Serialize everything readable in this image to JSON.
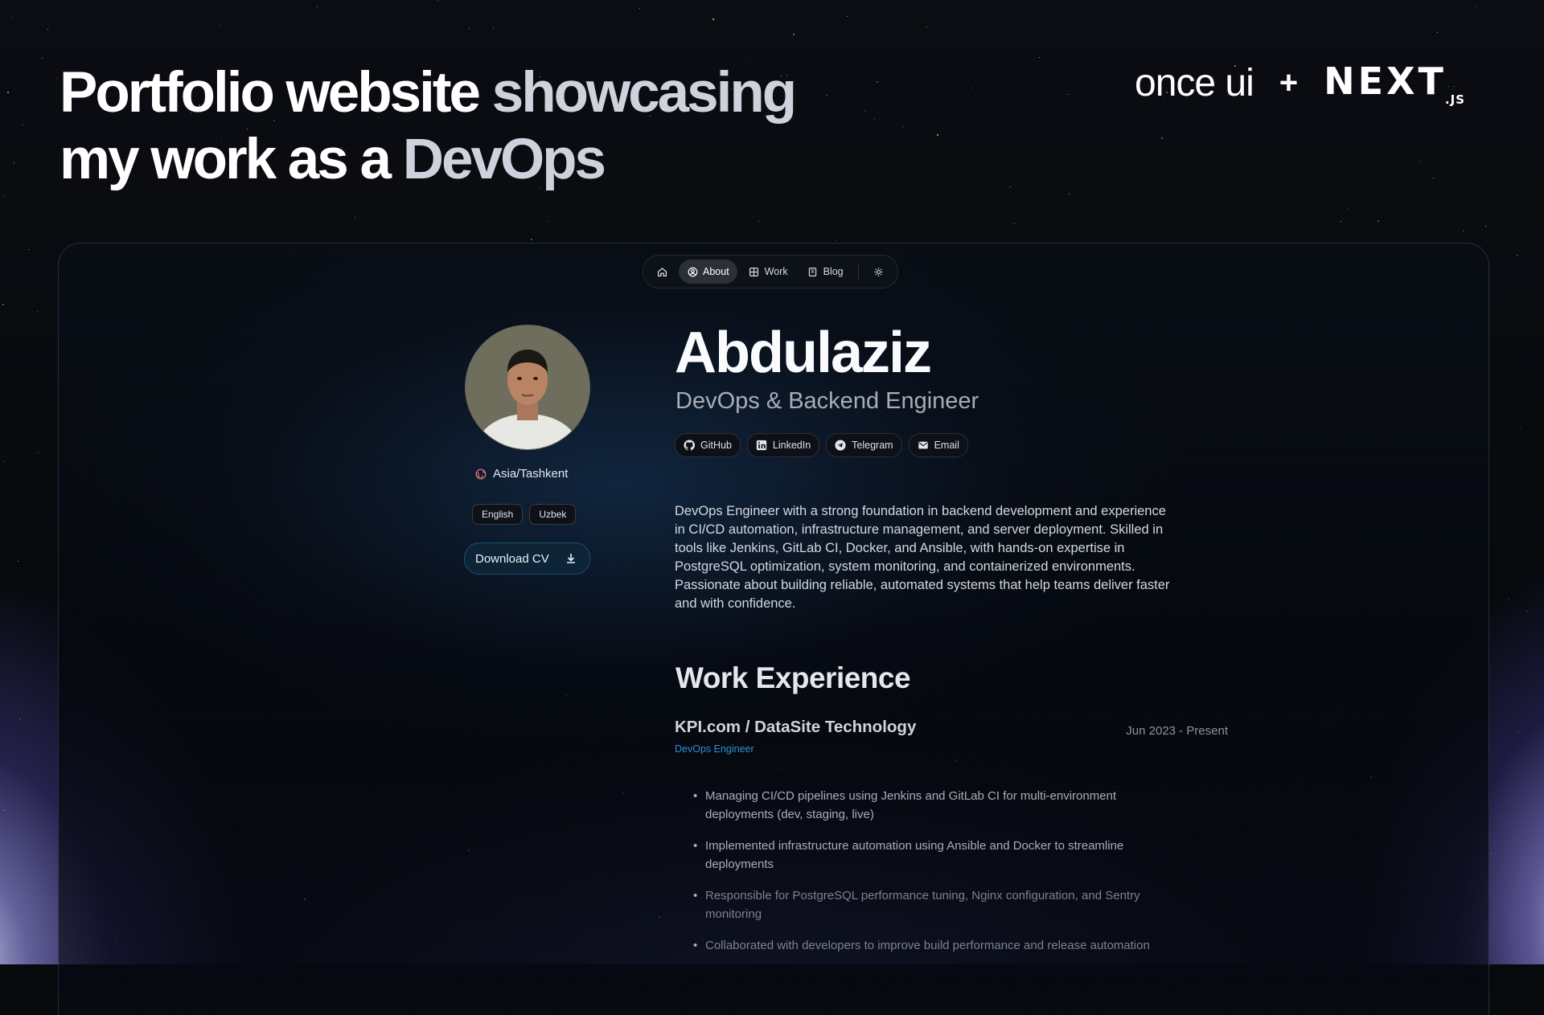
{
  "header": {
    "title_line1_bright": "Portfolio website ",
    "title_line1_dim": "showcasing",
    "title_line2_bright": "my work as a ",
    "title_line2_dim": "DevOps",
    "brand_once": "once ui",
    "brand_plus": "+",
    "brand_next": "NEXT",
    "brand_next_suffix": ".JS"
  },
  "nav": {
    "items": [
      {
        "label": "",
        "icon": "home-icon"
      },
      {
        "label": "About",
        "icon": "person-icon",
        "active": true
      },
      {
        "label": "Work",
        "icon": "grid-icon"
      },
      {
        "label": "Blog",
        "icon": "book-icon"
      }
    ],
    "theme_icon": "sun-icon"
  },
  "profile": {
    "location": "Asia/Tashkent",
    "languages": [
      "English",
      "Uzbek"
    ],
    "cv_label": "Download CV"
  },
  "about": {
    "name": "Abdulaziz",
    "role": "DevOps & Backend Engineer",
    "socials": [
      {
        "label": "GitHub",
        "icon": "github-icon"
      },
      {
        "label": "LinkedIn",
        "icon": "linkedin-icon"
      },
      {
        "label": "Telegram",
        "icon": "telegram-icon"
      },
      {
        "label": "Email",
        "icon": "email-icon"
      }
    ],
    "bio": "DevOps Engineer with a strong foundation in backend development and experience in CI/CD automation, infrastructure management, and server deployment. Skilled in tools like Jenkins, GitLab CI, Docker, and Ansible, with hands-on expertise in PostgreSQL optimization, system monitoring, and containerized environments. Passionate about building reliable, automated systems that help teams deliver faster and with confidence."
  },
  "experience": {
    "title": "Work Experience",
    "company": "KPI.com / DataSite Technology",
    "role": "DevOps Engineer",
    "period": "Jun 2023 - Present",
    "bullets": [
      "Managing CI/CD pipelines using Jenkins and GitLab CI for multi-environment deployments (dev, staging, live)",
      "Implemented infrastructure automation using Ansible and Docker to streamline deployments",
      "Responsible for PostgreSQL performance tuning, Nginx configuration, and Sentry monitoring",
      "Collaborated with developers to improve build performance and release automation"
    ]
  }
}
